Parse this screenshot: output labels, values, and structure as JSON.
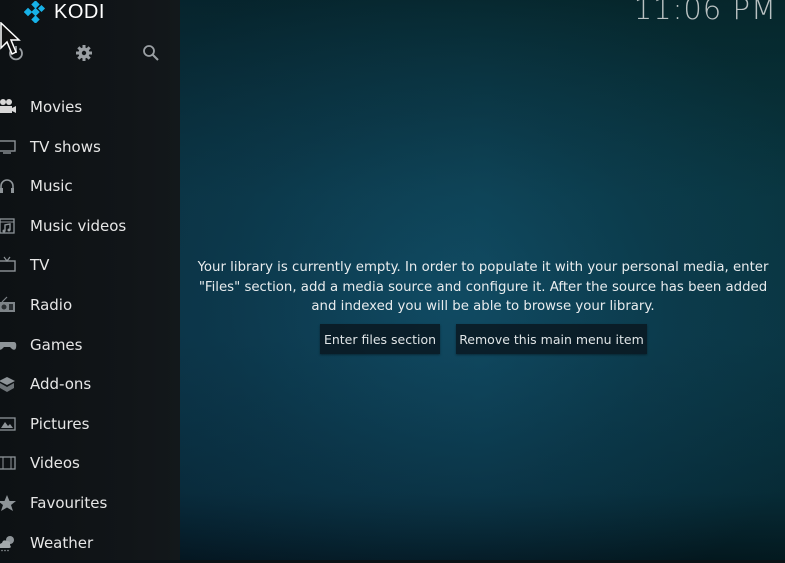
{
  "app": {
    "name": "KODI",
    "brand_color": "#17b2e8"
  },
  "topbar": {
    "clock": "11:06 PM",
    "icons": [
      {
        "name": "power-icon",
        "label": "Power"
      },
      {
        "name": "gear-icon",
        "label": "Settings"
      },
      {
        "name": "search-icon",
        "label": "Search"
      }
    ]
  },
  "sidebar": {
    "items": [
      {
        "label": "Movies",
        "icon": "movie-camera-icon"
      },
      {
        "label": "TV shows",
        "icon": "monitor-icon"
      },
      {
        "label": "Music",
        "icon": "headphones-icon"
      },
      {
        "label": "Music videos",
        "icon": "music-video-icon"
      },
      {
        "label": "TV",
        "icon": "tv-icon"
      },
      {
        "label": "Radio",
        "icon": "radio-icon"
      },
      {
        "label": "Games",
        "icon": "gamepad-icon"
      },
      {
        "label": "Add-ons",
        "icon": "addon-box-icon"
      },
      {
        "label": "Pictures",
        "icon": "picture-icon"
      },
      {
        "label": "Videos",
        "icon": "film-strip-icon"
      },
      {
        "label": "Favourites",
        "icon": "star-icon"
      },
      {
        "label": "Weather",
        "icon": "weather-icon"
      }
    ]
  },
  "main": {
    "message": "Your library is currently empty. In order to populate it with your personal media, enter \"Files\" section, add a media source and configure it. After the source has been added and indexed you will be able to browse your library.",
    "buttons": {
      "enter_files": "Enter files section",
      "remove_item": "Remove this main menu item"
    }
  }
}
